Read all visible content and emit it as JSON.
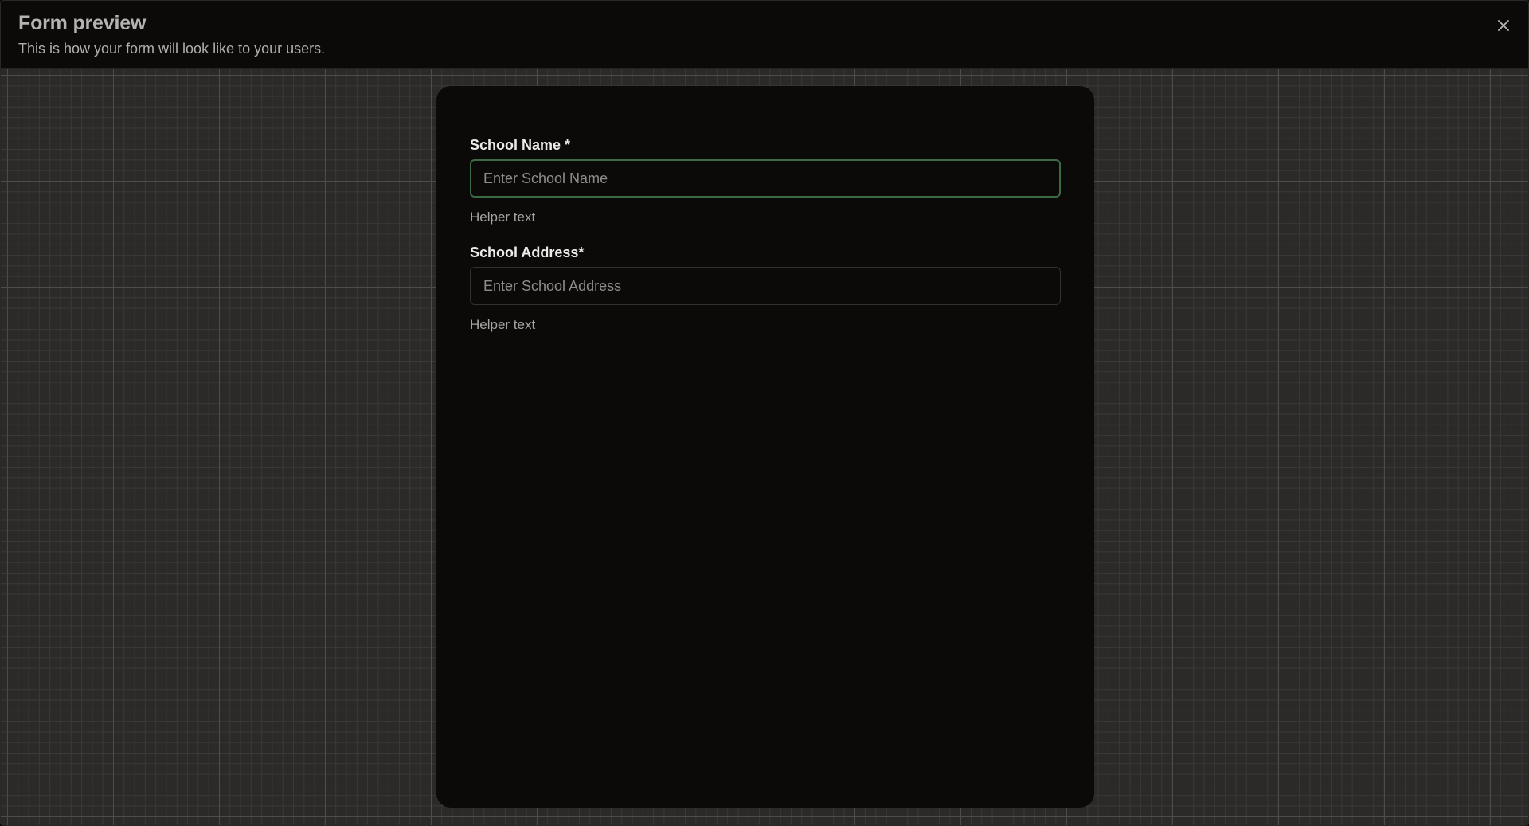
{
  "header": {
    "title": "Form preview",
    "subtitle": "This is how your form will look like to your users.",
    "close_icon": "close-icon"
  },
  "form": {
    "fields": [
      {
        "label": "School Name *",
        "placeholder": "Enter School Name",
        "value": "",
        "helper": "Helper text",
        "focused": true
      },
      {
        "label": "School Address*",
        "placeholder": "Enter School Address",
        "value": "",
        "helper": "Helper text",
        "focused": false
      }
    ]
  },
  "colors": {
    "background": "#0c0a09",
    "focus_border": "#3a6b45",
    "grid_line": "#4e4c48"
  }
}
